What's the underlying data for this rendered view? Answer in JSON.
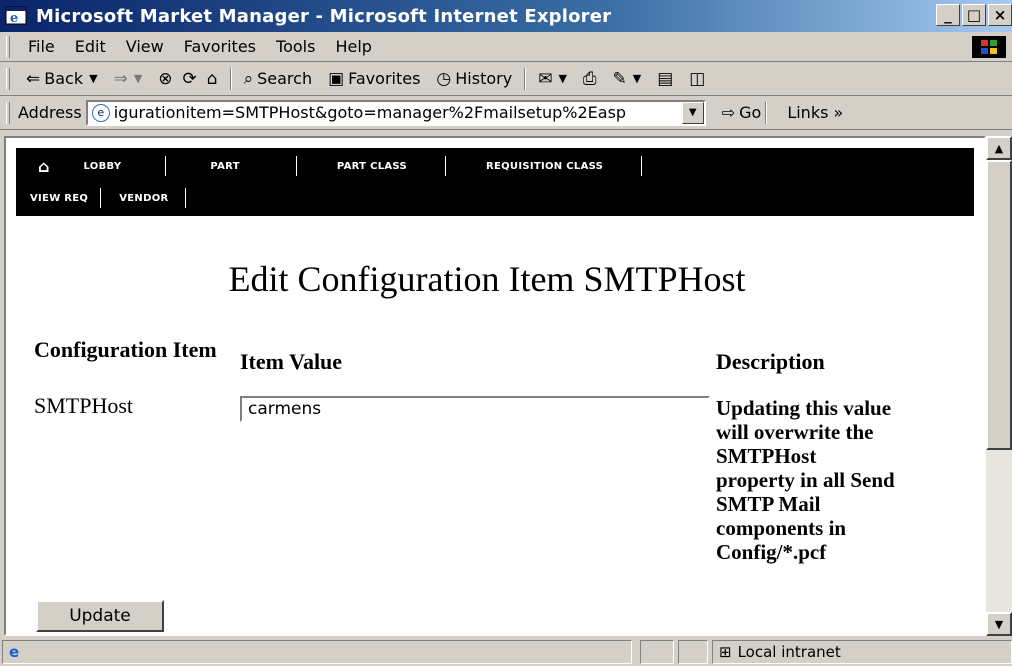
{
  "window": {
    "title": "Microsoft Market Manager - Microsoft Internet Explorer",
    "buttons": {
      "minimize": "_",
      "maximize": "□",
      "close": "×"
    }
  },
  "menu": {
    "items": [
      "File",
      "Edit",
      "View",
      "Favorites",
      "Tools",
      "Help"
    ]
  },
  "toolbar": {
    "back": "Back",
    "search": "Search",
    "favorites": "Favorites",
    "history": "History"
  },
  "address": {
    "label": "Address",
    "url": "igurationitem=SMTPHost&goto=manager%2Fmailsetup%2Easp",
    "go": "Go",
    "links": "Links »"
  },
  "site_nav": {
    "row1": [
      "LOBBY",
      "PART",
      "PART CLASS",
      "REQUISITION CLASS"
    ],
    "row2": [
      "VIEW REQ",
      "VENDOR"
    ]
  },
  "page": {
    "title": "Edit Configuration Item SMTPHost",
    "columns": {
      "item": "Configuration Item",
      "value": "Item Value",
      "description": "Description"
    },
    "row": {
      "item": "SMTPHost",
      "value": "carmens",
      "description": "Updating this value will overwrite the SMTPHost property in all Send SMTP Mail components in Config/*.pcf"
    },
    "update_button": "Update"
  },
  "status": {
    "zone": "Local intranet"
  }
}
